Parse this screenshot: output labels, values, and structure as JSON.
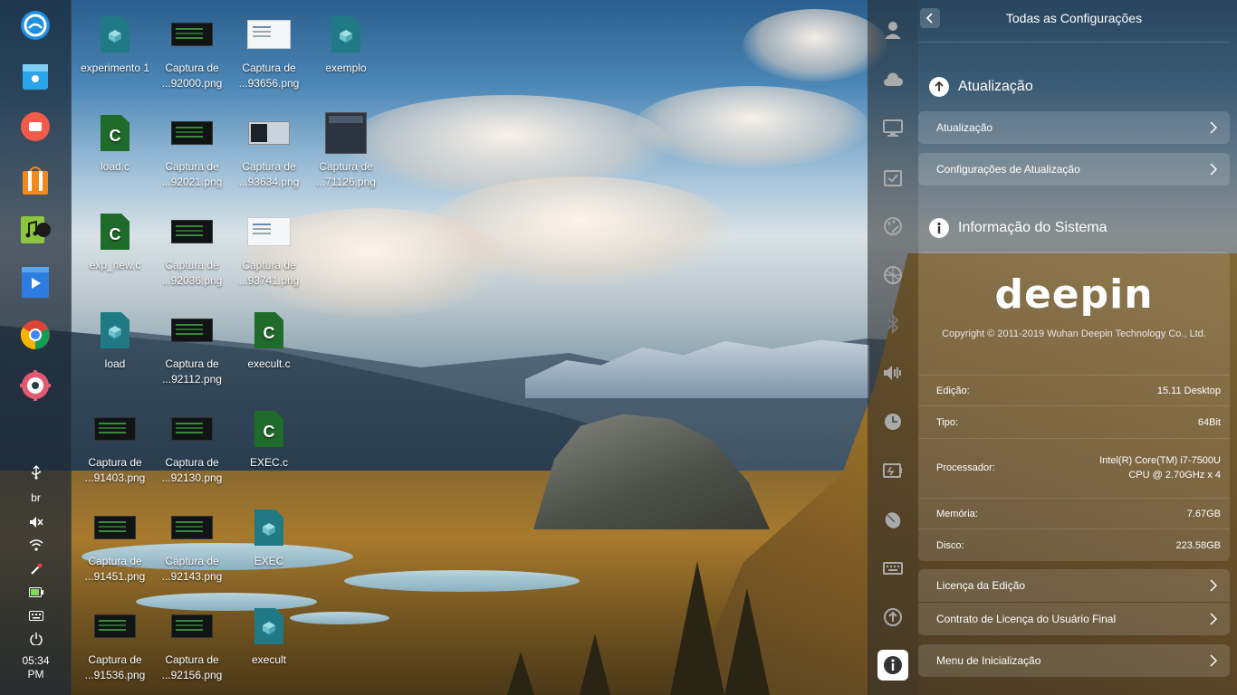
{
  "dock": {
    "tray": {
      "keyboard_layout": "br",
      "time": "05:34",
      "ampm": "PM"
    }
  },
  "desktop": {
    "icons": [
      {
        "label": "experimento 1",
        "type": "bin"
      },
      {
        "label": "Captura de ...92000.png",
        "type": "dark"
      },
      {
        "label": "Captura de ...93656.png",
        "type": "light"
      },
      {
        "label": "exemplo",
        "type": "bin"
      },
      {
        "label": "load.c",
        "type": "c"
      },
      {
        "label": "Captura de ...92021.png",
        "type": "dark"
      },
      {
        "label": "Captura de ...93634.png",
        "type": "mixed"
      },
      {
        "label": "Captura de ...71126.png",
        "type": "win"
      },
      {
        "label": "exp_new.c",
        "type": "c"
      },
      {
        "label": "Captura de ...92036.png",
        "type": "dark"
      },
      {
        "label": "Captura de ...93741.png",
        "type": "light"
      },
      {
        "label": "load",
        "type": "bin"
      },
      {
        "label": "Captura de ...92112.png",
        "type": "dark"
      },
      {
        "label": "execult.c",
        "type": "c"
      },
      {
        "label": "Captura de ...91403.png",
        "type": "dark"
      },
      {
        "label": "Captura de ...92130.png",
        "type": "dark"
      },
      {
        "label": "EXEC.c",
        "type": "c"
      },
      {
        "label": "Captura de ...91451.png",
        "type": "dark"
      },
      {
        "label": "Captura de ...92143.png",
        "type": "dark"
      },
      {
        "label": "EXEC",
        "type": "bin"
      },
      {
        "label": "Captura de ...91536.png",
        "type": "dark"
      },
      {
        "label": "Captura de ...92156.png",
        "type": "dark"
      },
      {
        "label": "execult",
        "type": "bin"
      }
    ]
  },
  "settings": {
    "title": "Todas as Configurações",
    "update_section": {
      "title": "Atualização",
      "rows": [
        "Atualização",
        "Configurações de Atualização"
      ]
    },
    "info_section": {
      "title": "Informação do Sistema",
      "logo_text": "deepin",
      "copyright": "Copyright © 2011-2019 Wuhan Deepin Technology Co., Ltd.",
      "edition_label": "Edição:",
      "edition_value": "15.11 Desktop",
      "type_label": "Tipo:",
      "type_value": "64Bit",
      "processor_label": "Processador:",
      "processor_value_1": "Intel(R) Core(TM) i7-7500U",
      "processor_value_2": "CPU @ 2.70GHz x 4",
      "memory_label": "Memória:",
      "memory_value": "7.67GB",
      "disk_label": "Disco:",
      "disk_value": "223.58GB"
    },
    "license_rows": [
      "Licença da Edição",
      "Contrato de Licença do Usuário Final"
    ],
    "boot_row": "Menu de Inicialização"
  },
  "colors": {
    "settings_bg": "#2a2a2a",
    "c_file": "#1e6b2a",
    "bin_file": "#1f7a86"
  }
}
